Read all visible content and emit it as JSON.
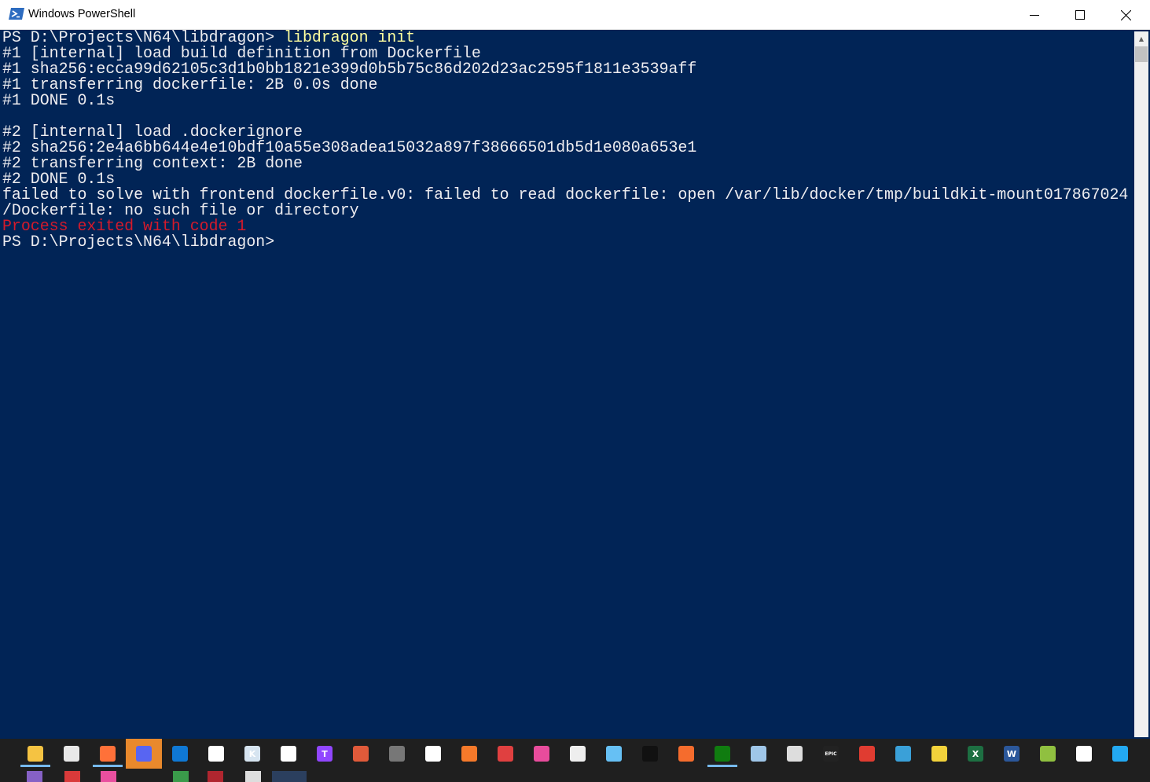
{
  "window": {
    "title": "Windows PowerShell",
    "icon": "powershell-icon",
    "controls": [
      "minimize-icon",
      "maximize-icon",
      "close-icon"
    ]
  },
  "console": {
    "lines": [
      {
        "text": "PS D:\\Projects\\N64\\libdragon> ",
        "cmd": "libdragon init"
      },
      {
        "text": "#1 [internal] load build definition from Dockerfile"
      },
      {
        "text": "#1 sha256:ecca99d62105c3d1b0bb1821e399d0b5b75c86d202d23ac2595f1811e3539aff"
      },
      {
        "text": "#1 transferring dockerfile: 2B 0.0s done"
      },
      {
        "text": "#1 DONE 0.1s"
      },
      {
        "text": ""
      },
      {
        "text": "#2 [internal] load .dockerignore"
      },
      {
        "text": "#2 sha256:2e4a6bb644e4e10bdf10a55e308adea15032a897f38666501db5d1e080a653e1"
      },
      {
        "text": "#2 transferring context: 2B done"
      },
      {
        "text": "#2 DONE 0.1s"
      },
      {
        "text": "failed to solve with frontend dockerfile.v0: failed to read dockerfile: open /var/lib/docker/tmp/buildkit-mount017867024"
      },
      {
        "text": "/Dockerfile: no such file or directory"
      },
      {
        "text": "Process exited with code 1",
        "error": true
      },
      {
        "text": "PS D:\\Projects\\N64\\libdragon>"
      }
    ]
  },
  "colors": {
    "console_bg": "#012456",
    "console_fg": "#eeedf0",
    "command_fg": "#ffff9f",
    "error_fg": "#d41a2b"
  },
  "taskbar": {
    "items": [
      {
        "name": "file-explorer-icon",
        "color": "#f5c342",
        "glyph": "",
        "running": true
      },
      {
        "name": "microsoft-store-icon",
        "color": "#e8e8e8",
        "glyph": ""
      },
      {
        "name": "firefox-icon",
        "color": "#ff7139",
        "glyph": "",
        "running": true
      },
      {
        "name": "discord-icon",
        "color": "#5865f2",
        "glyph": "",
        "active": true
      },
      {
        "name": "mail-icon",
        "color": "#0f78d4",
        "glyph": ""
      },
      {
        "name": "fox-app-icon",
        "color": "#ffffff",
        "glyph": ""
      },
      {
        "name": "krita-icon",
        "color": "#d6e4f0",
        "glyph": "K"
      },
      {
        "name": "chat-bubble-icon",
        "color": "#ffffff",
        "glyph": ""
      },
      {
        "name": "twitch-app-icon",
        "color": "#9146ff",
        "glyph": "T"
      },
      {
        "name": "pencil-app-icon",
        "color": "#e05a3a",
        "glyph": ""
      },
      {
        "name": "game-app-icon",
        "color": "#777777",
        "glyph": ""
      },
      {
        "name": "crescent-app-icon",
        "color": "#ffffff",
        "glyph": ""
      },
      {
        "name": "blender-icon",
        "color": "#f5792a",
        "glyph": ""
      },
      {
        "name": "tools-app-icon",
        "color": "#e04040",
        "glyph": ""
      },
      {
        "name": "photo-app-icon",
        "color": "#e84c9c",
        "glyph": ""
      },
      {
        "name": "skater-app-icon",
        "color": "#eeeeee",
        "glyph": ""
      },
      {
        "name": "steam-icon",
        "color": "#66c0f4",
        "glyph": ""
      },
      {
        "name": "games-launcher-icon",
        "color": "#111111",
        "glyph": ""
      },
      {
        "name": "origin-icon",
        "color": "#f56c2d",
        "glyph": ""
      },
      {
        "name": "xbox-icon",
        "color": "#107c10",
        "glyph": "",
        "running": true
      },
      {
        "name": "3d-viewer-icon",
        "color": "#9fc6e8",
        "glyph": ""
      },
      {
        "name": "unity-icon",
        "color": "#dddddd",
        "glyph": ""
      },
      {
        "name": "epic-games-icon",
        "color": "#222222",
        "glyph": "EPIC"
      },
      {
        "name": "multicolor-app-icon",
        "color": "#e03c31",
        "glyph": ""
      },
      {
        "name": "dolphin-emulator-icon",
        "color": "#3aa0d8",
        "glyph": ""
      },
      {
        "name": "lemon-app-icon",
        "color": "#f2d23b",
        "glyph": ""
      },
      {
        "name": "excel-icon",
        "color": "#1d6f42",
        "glyph": "X"
      },
      {
        "name": "word-icon",
        "color": "#2b579a",
        "glyph": "W"
      },
      {
        "name": "notepad-plus-icon",
        "color": "#90c040",
        "glyph": ""
      },
      {
        "name": "circle-app-icon",
        "color": "#ffffff",
        "glyph": ""
      },
      {
        "name": "vscode-icon",
        "color": "#23a9f2",
        "glyph": ""
      }
    ],
    "second_row": [
      {
        "name": "visual-studio-icon",
        "color": "#8661c5"
      },
      {
        "name": "red-app-icon",
        "color": "#d93a3a"
      },
      {
        "name": "ide-app-icon",
        "color": "#e94f9f"
      },
      {
        "name": "green-app-icon",
        "color": "#3a9a4a"
      },
      {
        "name": "dark-red-app-icon",
        "color": "#b0262f"
      },
      {
        "name": "settings-icon",
        "color": "#dddddd"
      },
      {
        "name": "powershell-taskbar-icon",
        "color": "#2a6fbf",
        "active": true
      }
    ]
  }
}
